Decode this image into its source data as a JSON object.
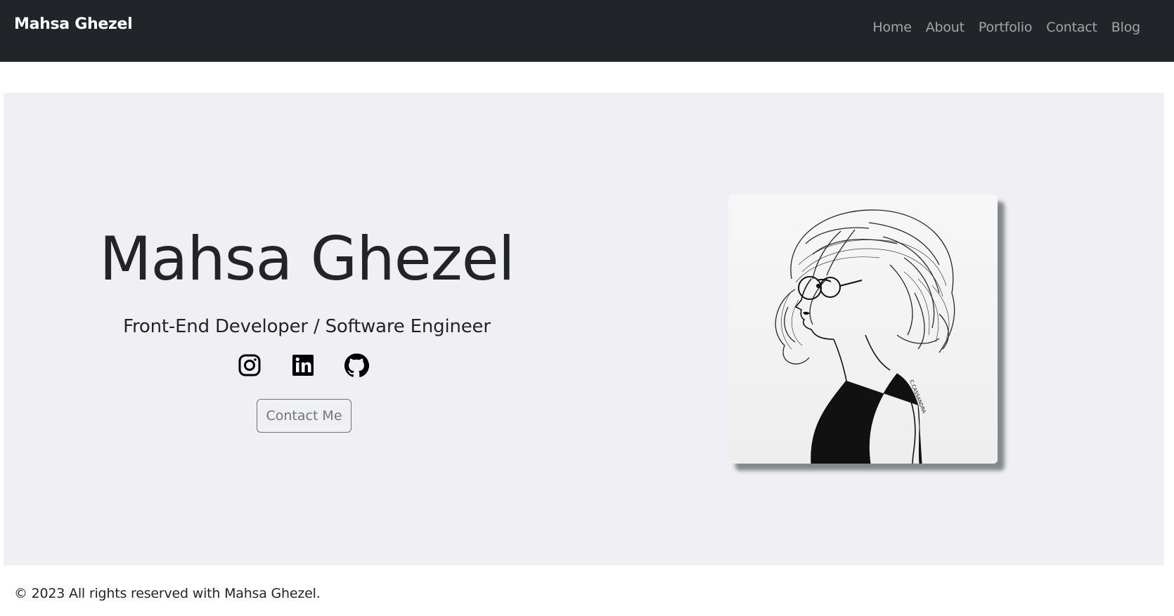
{
  "navbar": {
    "brand": "Mahsa Ghezel",
    "links": [
      {
        "label": "Home"
      },
      {
        "label": "About"
      },
      {
        "label": "Portfolio"
      },
      {
        "label": "Contact"
      },
      {
        "label": "Blog"
      }
    ]
  },
  "hero": {
    "name": "Mahsa Ghezel",
    "subtitle": "Front-End Developer / Software Engineer",
    "socials": [
      {
        "icon": "instagram-icon"
      },
      {
        "icon": "linkedin-icon"
      },
      {
        "icon": "github-icon"
      }
    ],
    "contact_button": "Contact Me",
    "portrait_signature": "C.CASSANDRA"
  },
  "footer": {
    "copyright": "© 2023 All rights reserved with Mahsa Ghezel."
  },
  "colors": {
    "navbar_bg": "#212529",
    "hero_bg": "#f0eff4",
    "text": "#212529",
    "muted": "#6c757d"
  }
}
